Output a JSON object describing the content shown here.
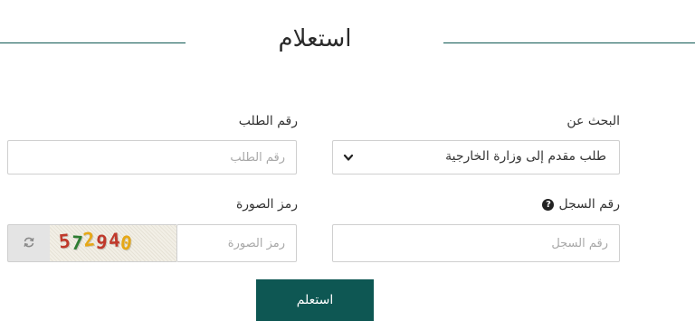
{
  "header": {
    "title": "استعلام"
  },
  "form": {
    "search_for_label": "البحث عن",
    "search_for_value": "طلب مقدم إلى وزارة الخارجية",
    "request_number_label": "رقم الطلب",
    "request_number_placeholder": "رقم الطلب",
    "registry_number_label": "رقم السجل",
    "registry_number_placeholder": "رقم السجل",
    "captcha_label": "رمز الصورة",
    "captcha_placeholder": "رمز الصورة",
    "captcha_digits": [
      {
        "char": "5",
        "color": "#c0392b"
      },
      {
        "char": "7",
        "color": "#2e7d32"
      },
      {
        "char": "2",
        "color": "#e6a817"
      },
      {
        "char": "9",
        "color": "#c0392b"
      },
      {
        "char": "4",
        "color": "#c0392b"
      },
      {
        "char": "0",
        "color": "#e6a817"
      }
    ],
    "submit_label": "استعلم"
  },
  "colors": {
    "accent": "#0e5753"
  }
}
